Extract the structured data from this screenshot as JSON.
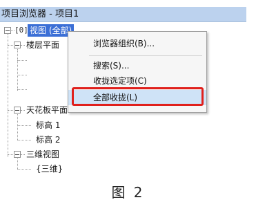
{
  "header": {
    "title": "项目浏览器 - 项目1"
  },
  "tree": {
    "root": {
      "label": "视图 (全部)"
    },
    "floor_plans": {
      "label": "楼层平面"
    },
    "ceiling_plans": {
      "label": "天花板平面",
      "children": [
        {
          "label": "标高 1"
        },
        {
          "label": "标高 2"
        }
      ]
    },
    "three_d_views": {
      "label": "三维视图",
      "children": [
        {
          "label": "{三维}"
        }
      ]
    }
  },
  "context_menu": {
    "items": [
      {
        "label": "浏览器组织(B)..."
      },
      {
        "label": "搜索(S)..."
      },
      {
        "label": "收拢选定项(C)"
      },
      {
        "label": "全部收拢(L)"
      }
    ]
  },
  "caption": "图 2",
  "colors": {
    "header_bg": "#bcd2ee",
    "selection_bg": "#3b6fd6",
    "highlight_box": "#e0201c"
  }
}
